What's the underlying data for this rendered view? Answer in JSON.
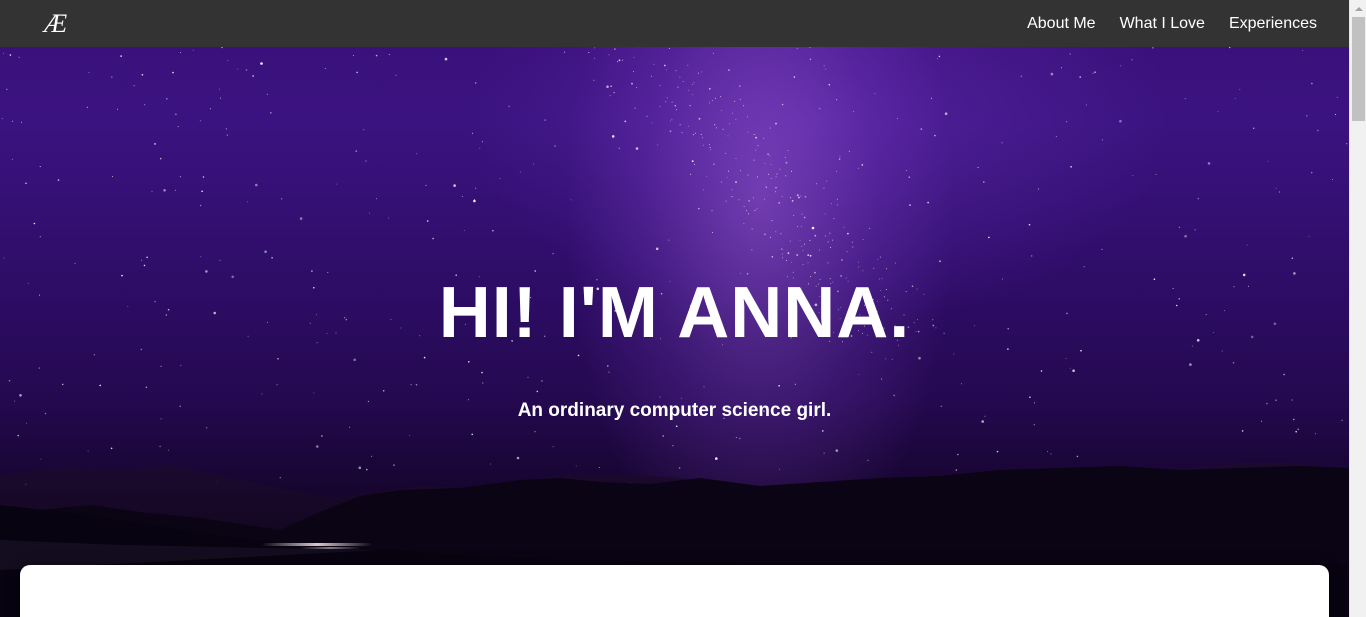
{
  "navbar": {
    "logo": "Æ",
    "links": [
      {
        "label": "About Me"
      },
      {
        "label": "What I Love"
      },
      {
        "label": "Experiences"
      }
    ]
  },
  "hero": {
    "title": "HI! I'M ANNA.",
    "subtitle": "An ordinary computer science girl."
  },
  "colors": {
    "navbar_bg": "#333333",
    "hero_sky_top": "#3a0f7a",
    "hero_sky_bottom": "#0d0319",
    "text": "#ffffff"
  }
}
